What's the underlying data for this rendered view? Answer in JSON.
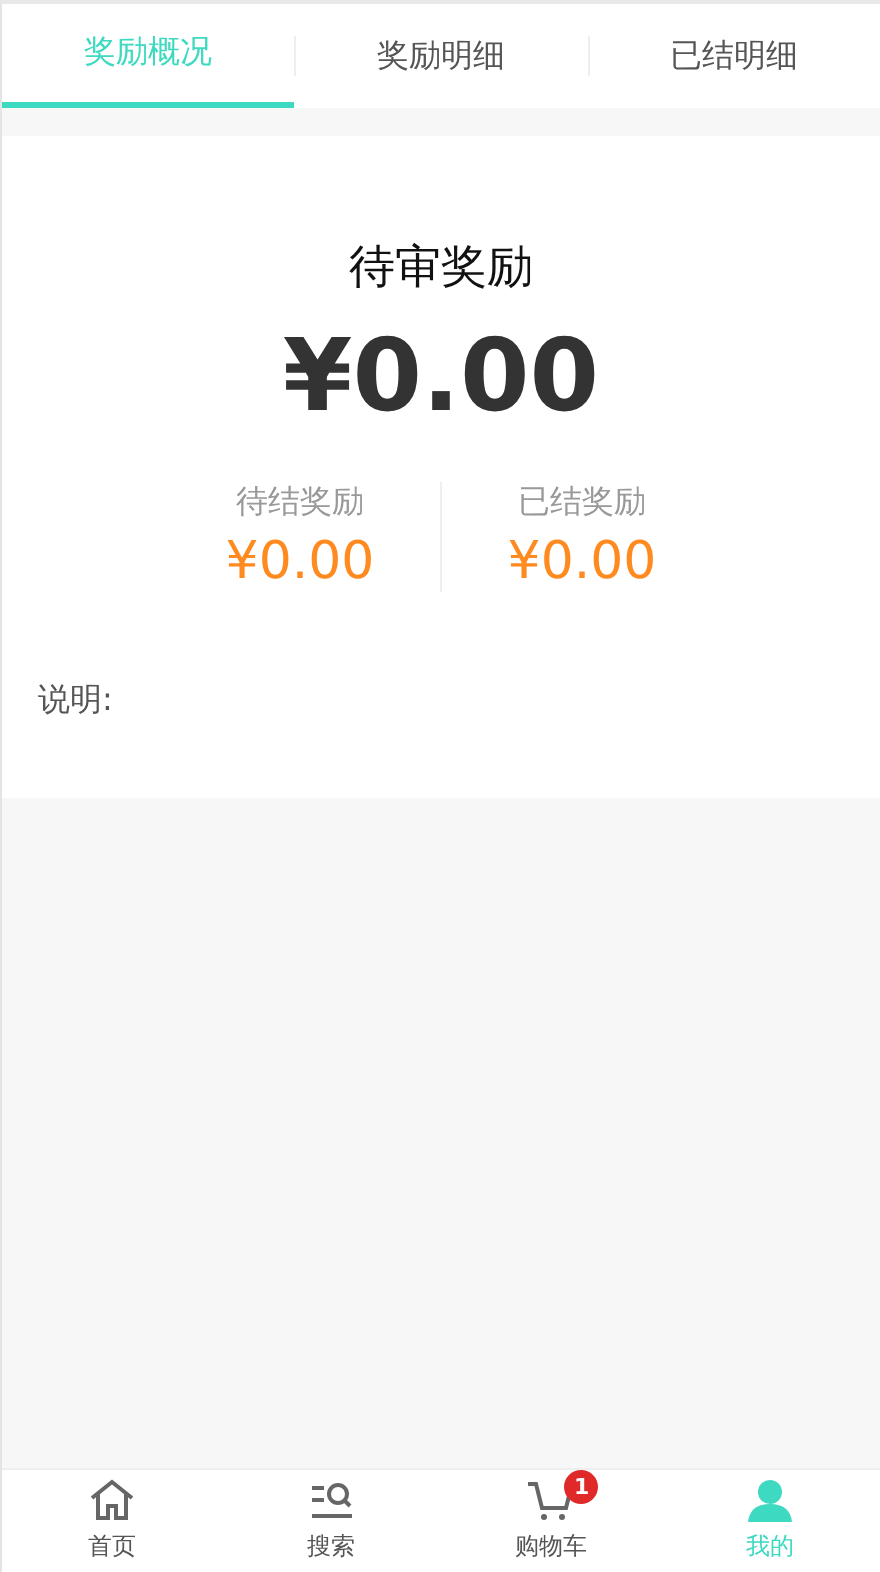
{
  "tabs": [
    {
      "label": "奖励概况",
      "selected": true
    },
    {
      "label": "奖励明细",
      "selected": false
    },
    {
      "label": "已结明细",
      "selected": false
    }
  ],
  "summary": {
    "title": "待审奖励",
    "amount": "¥0.00"
  },
  "stats": [
    {
      "label": "待结奖励",
      "amount": "¥0.00"
    },
    {
      "label": "已结奖励",
      "amount": "¥0.00"
    }
  ],
  "note": "说明:",
  "nav": [
    {
      "kind": "home",
      "label": "首页",
      "selected": false
    },
    {
      "kind": "search",
      "label": "搜索",
      "selected": false
    },
    {
      "kind": "cart",
      "label": "购物车",
      "selected": false,
      "badge": "1"
    },
    {
      "kind": "user",
      "label": "我的",
      "selected": true
    }
  ]
}
